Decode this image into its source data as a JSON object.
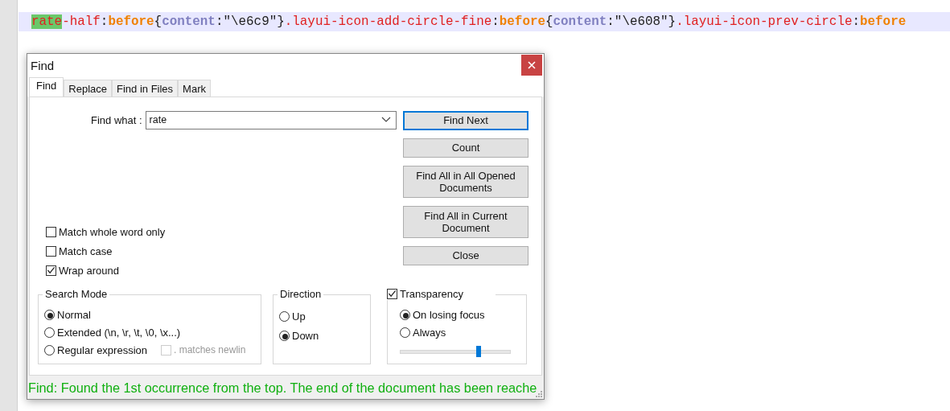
{
  "editor": {
    "code_tokens": [
      {
        "text": "rate",
        "kind": "match"
      },
      {
        "text": "-half",
        "kind": "selector"
      },
      {
        "text": ":",
        "kind": "punct"
      },
      {
        "text": "before",
        "kind": "pseudo"
      },
      {
        "text": "{",
        "kind": "punct"
      },
      {
        "text": "content",
        "kind": "property"
      },
      {
        "text": ":\"\\e6c9\"}",
        "kind": "punct"
      },
      {
        "text": ".layui-icon-add-circle-fine",
        "kind": "selector"
      },
      {
        "text": ":",
        "kind": "punct"
      },
      {
        "text": "before",
        "kind": "pseudo"
      },
      {
        "text": "{",
        "kind": "punct"
      },
      {
        "text": "content",
        "kind": "property"
      },
      {
        "text": ":\"\\e608\"}",
        "kind": "punct"
      },
      {
        "text": ".layui-icon-prev-circle",
        "kind": "selector"
      },
      {
        "text": ":",
        "kind": "punct"
      },
      {
        "text": "before",
        "kind": "pseudo"
      }
    ]
  },
  "dialog": {
    "title": "Find",
    "tabs": [
      {
        "label": "Find",
        "selected": true
      },
      {
        "label": "Replace",
        "selected": false
      },
      {
        "label": "Find in Files",
        "selected": false
      },
      {
        "label": "Mark",
        "selected": false
      }
    ],
    "find_what": {
      "label": "Find what :",
      "value": "rate"
    },
    "buttons": [
      {
        "label": "Find Next",
        "selected": true
      },
      {
        "label": "Count",
        "selected": false
      },
      {
        "label": "Find All in All Opened Documents",
        "selected": false
      },
      {
        "label": "Find All in Current Document",
        "selected": false
      },
      {
        "label": "Close",
        "selected": false
      }
    ],
    "options": [
      {
        "label": "Match whole word only",
        "checked": false
      },
      {
        "label": "Match case",
        "checked": false
      },
      {
        "label": "Wrap around",
        "checked": true
      }
    ],
    "search_mode": {
      "title": "Search Mode",
      "options": [
        {
          "label": "Normal",
          "selected": true
        },
        {
          "label": "Extended (\\n, \\r, \\t, \\0, \\x...)",
          "selected": false
        },
        {
          "label": "Regular expression",
          "selected": false
        }
      ],
      "extra_option": {
        "label": ". matches newlin",
        "checked": false,
        "disabled": true
      }
    },
    "direction": {
      "title": "Direction",
      "options": [
        {
          "label": "Up",
          "selected": false
        },
        {
          "label": "Down",
          "selected": true
        }
      ]
    },
    "transparency": {
      "label": "Transparency",
      "checked": true,
      "options": [
        {
          "label": "On losing focus",
          "selected": true
        },
        {
          "label": "Always",
          "selected": false
        }
      ],
      "level": 0.71
    },
    "status": "Find: Found the 1st occurrence from the top. The end of the document has been reache"
  }
}
